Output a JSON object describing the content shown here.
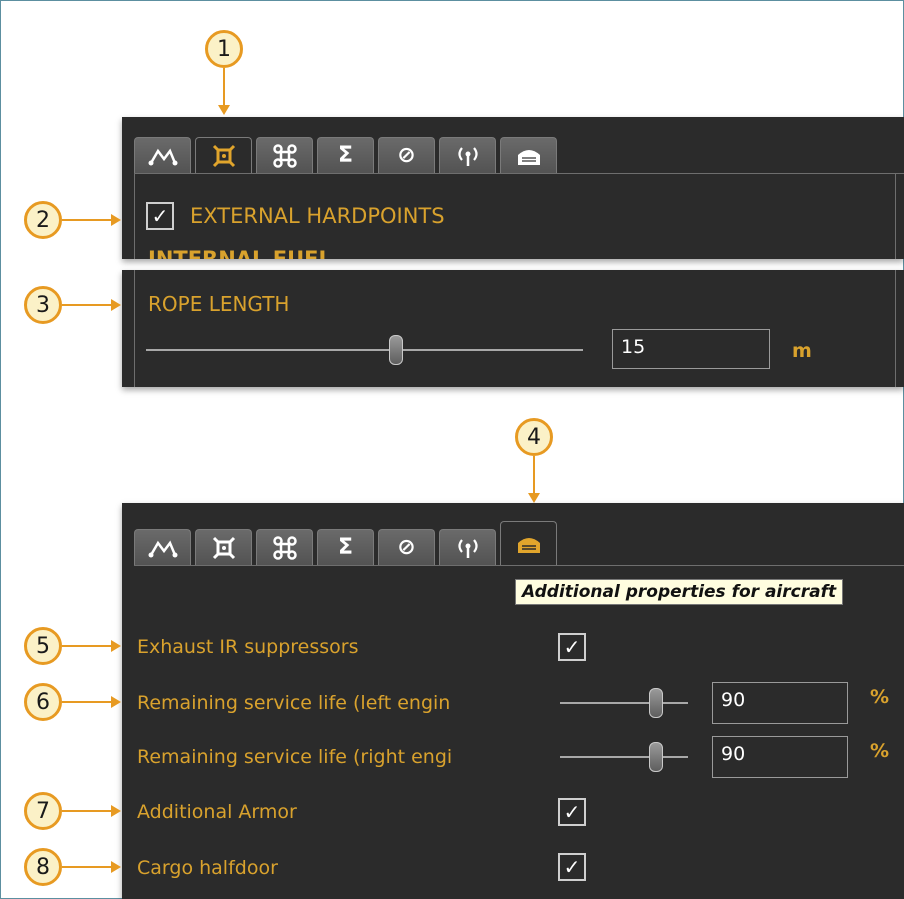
{
  "tabs": [
    {
      "icon": "route-icon",
      "glyph": "⁀"
    },
    {
      "icon": "hardpoints-icon",
      "glyph": "⌘"
    },
    {
      "icon": "drone-icon",
      "glyph": "⌘"
    },
    {
      "icon": "sigma-icon",
      "glyph": "Σ"
    },
    {
      "icon": "prohibited-icon",
      "glyph": "⊘"
    },
    {
      "icon": "radio-icon",
      "glyph": "⍦"
    },
    {
      "icon": "hangar-icon",
      "glyph": "⏏"
    }
  ],
  "callouts": [
    "1",
    "2",
    "3",
    "4",
    "5",
    "6",
    "7",
    "8"
  ],
  "top_panel": {
    "external_hardpoints_label": "EXTERNAL HARDPOINTS",
    "external_hardpoints_checked": true,
    "clipped_label": "INTERNAL FUEL"
  },
  "rope_panel": {
    "label": "ROPE LENGTH",
    "value": "15",
    "unit": "m",
    "slider_fraction": 0.55
  },
  "bottom_panel": {
    "tooltip": "Additional properties for aircraft",
    "rows": {
      "exhaust_label": "Exhaust IR suppressors",
      "exhaust_checked": true,
      "left_engine_label": "Remaining service life (left engin",
      "left_engine_value": "90",
      "left_engine_unit": "%",
      "right_engine_label": "Remaining service life (right engi",
      "right_engine_value": "90",
      "right_engine_unit": "%",
      "armor_label": "Additional Armor",
      "armor_checked": true,
      "cargo_label": "Cargo halfdoor",
      "cargo_checked": true
    }
  },
  "colors": {
    "accent": "#d9a22d",
    "panel_bg": "#2b2b2b",
    "callout_border": "#e79a22",
    "callout_fill": "#fbf1c7"
  }
}
